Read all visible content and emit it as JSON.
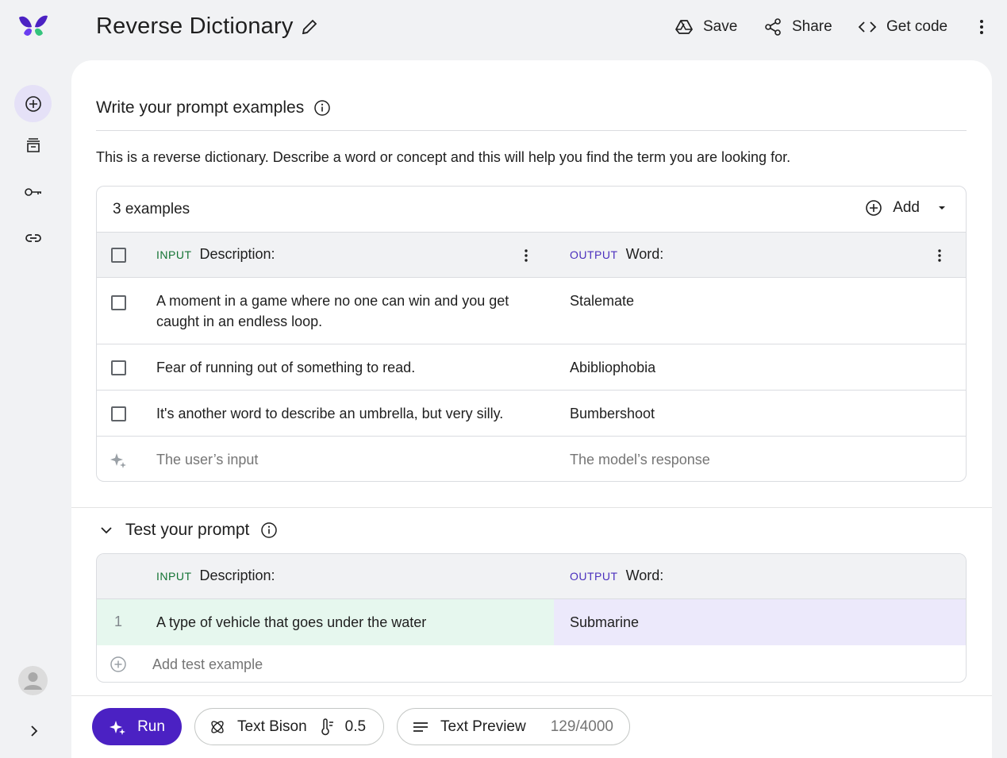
{
  "header": {
    "title": "Reverse Dictionary",
    "save_label": "Save",
    "share_label": "Share",
    "get_code_label": "Get code"
  },
  "examples_section": {
    "title": "Write your prompt examples",
    "description": "This is a reverse dictionary. Describe a word or concept and this will help you find the term you are looking for.",
    "count_label": "3 examples",
    "add_label": "Add",
    "columns": {
      "input_tag": "INPUT",
      "input_name": "Description:",
      "output_tag": "OUTPUT",
      "output_name": "Word:"
    },
    "rows": [
      {
        "input_line1": "A moment in a game where no one can win and you get",
        "input_line2": "caught in an endless loop.",
        "output": "Stalemate"
      },
      {
        "input": "Fear of running out of something to read.",
        "output": "Abibliophobia"
      },
      {
        "input": "It's another word to describe an umbrella, but very silly.",
        "output": "Bumbershoot"
      }
    ],
    "new_row": {
      "input_placeholder": "The user’s input",
      "output_placeholder": "The model’s response"
    }
  },
  "test_section": {
    "title": "Test your prompt",
    "columns": {
      "input_tag": "INPUT",
      "input_name": "Description:",
      "output_tag": "OUTPUT",
      "output_name": "Word:"
    },
    "rows": [
      {
        "num": "1",
        "input": "A type of vehicle that goes under the water",
        "output": "Submarine"
      }
    ],
    "add_test_label": "Add test example"
  },
  "bottom_bar": {
    "run_label": "Run",
    "model_label": "Text Bison",
    "temperature": "0.5",
    "preview_label": "Text Preview",
    "token_count": "129/4000"
  },
  "colors": {
    "accent": "#4b21c3",
    "input_tag": "#137333",
    "output_tag": "#4a2fbd",
    "input_highlight": "#e6f7ee",
    "output_highlight": "#ece9fb"
  }
}
